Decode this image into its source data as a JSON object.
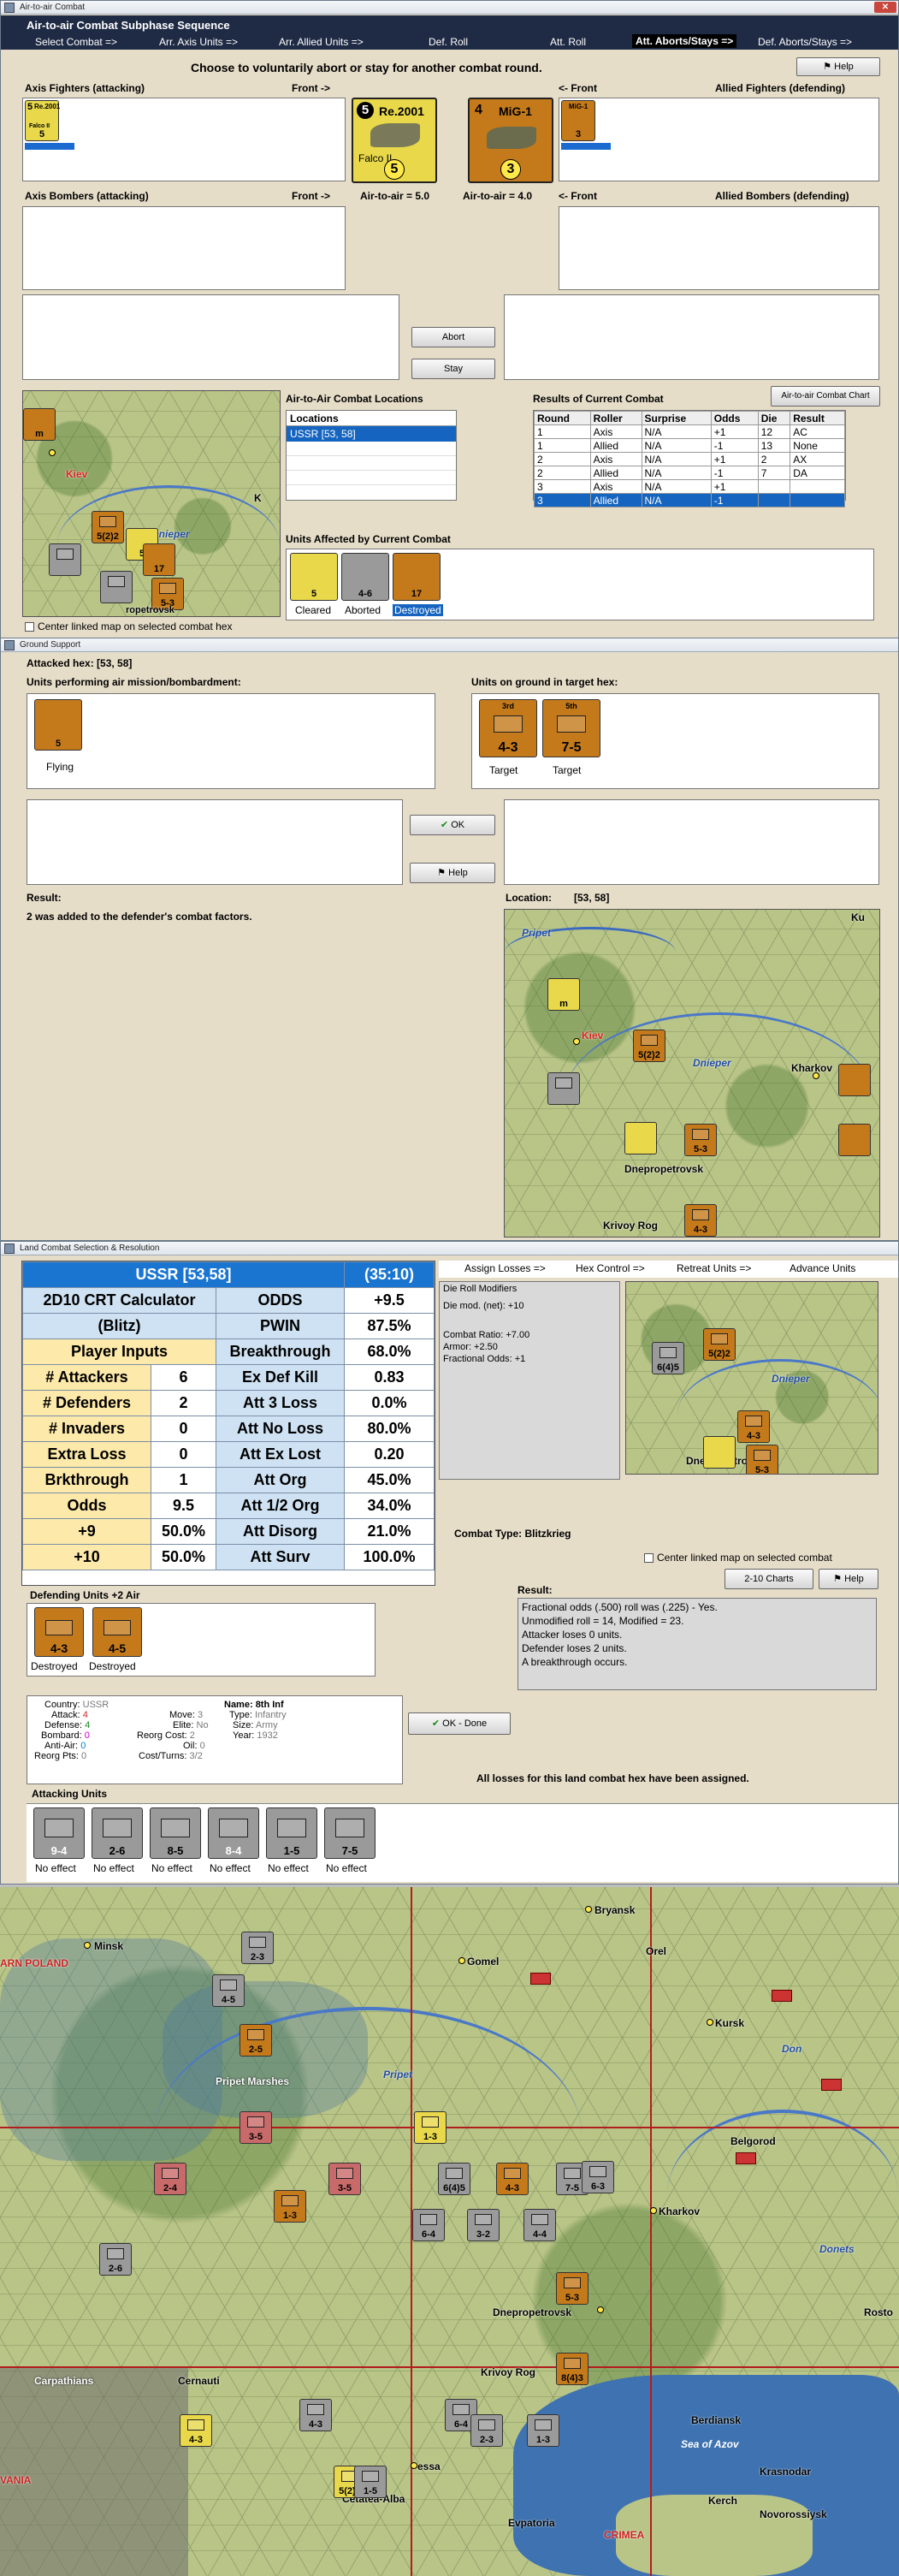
{
  "air_combat": {
    "window_title": "Air-to-air Combat",
    "panel_title": "Air-to-air Combat Subphase Sequence",
    "close": "✕",
    "tabs": [
      "Select Combat =>",
      "Arr. Axis Units =>",
      "Arr. Allied Units =>",
      "Def. Roll",
      "Att. Roll",
      "Att. Aborts/Stays =>",
      "Def. Aborts/Stays =>"
    ],
    "help": "Help",
    "instruction": "Choose to voluntarily abort or stay for another combat round.",
    "axis_fighters_label": "Axis Fighters (attacking)",
    "front_left": "Front ->",
    "front_right": "<- Front",
    "allied_fighters_label": "Allied Fighters (defending)",
    "axis_bombers_label": "Axis Bombers (attacking)",
    "allied_bombers_label": "Allied Bombers (defending)",
    "air_to_air_left": "Air-to-air = 5.0",
    "air_to_air_right": "Air-to-air = 4.0",
    "big_axis_counter": {
      "top": "5",
      "name": "Re.2001",
      "sub": "Falco II",
      "value": "5"
    },
    "big_soviet_counter": {
      "top": "4",
      "name": "MiG-1",
      "value": "3"
    },
    "small_axis_counter": {
      "top": "5",
      "name": "Re.2001",
      "sub": "Falco II",
      "value": "5"
    },
    "small_soviet_counter": {
      "name": "MiG-1",
      "value": "3"
    },
    "abort": "Abort",
    "stay": "Stay",
    "locations_title": "Air-to-Air Combat Locations",
    "locations_header": "Locations",
    "locations": [
      "USSR [53, 58]"
    ],
    "results_title": "Results of Current Combat",
    "chart_button": "Air-to-air Combat Chart",
    "results_headers": [
      "Round",
      "Roller",
      "Surprise",
      "Odds",
      "Die",
      "Result"
    ],
    "results_rows": [
      [
        "1",
        "Axis",
        "N/A",
        "+1",
        "12",
        "AC"
      ],
      [
        "1",
        "Allied",
        "N/A",
        "-1",
        "13",
        "None"
      ],
      [
        "2",
        "Axis",
        "N/A",
        "+1",
        "2",
        "AX"
      ],
      [
        "2",
        "Allied",
        "N/A",
        "-1",
        "7",
        "DA"
      ],
      [
        "3",
        "Axis",
        "N/A",
        "+1",
        "",
        ""
      ],
      [
        "3",
        "Allied",
        "N/A",
        "-1",
        "",
        ""
      ]
    ],
    "affected_title": "Units Affected by Current Combat",
    "affected": [
      {
        "label": "Cleared",
        "value": "5"
      },
      {
        "label": "Aborted",
        "value": "4-6"
      },
      {
        "label": "Destroyed",
        "value": "17"
      }
    ],
    "center_linked": "Center linked map on selected combat hex",
    "map": {
      "kiev": "Kiev",
      "dnieper": "Dnieper",
      "k": "K",
      "m": "m",
      "unit_a": "5(2)2",
      "unit_b": "5-3",
      "unit_c": "5",
      "unit_d": "17",
      "town": "ropetrovsk"
    }
  },
  "ground_support": {
    "window_title": "Ground Support",
    "attacked_hex": "Attacked hex:  [53, 58]",
    "air_units_label": "Units performing air mission/bombardment:",
    "ground_units_label": "Units on ground in target hex:",
    "flying_unit": {
      "value": "5",
      "label": "Flying"
    },
    "targets": [
      {
        "value": "4-3",
        "label": "Target",
        "top": "3rd"
      },
      {
        "value": "7-5",
        "label": "Target",
        "top": "5th"
      }
    ],
    "ok": "OK",
    "help": "Help",
    "result_label": "Result:",
    "result_text": "2 was added to the defender's combat factors.",
    "location_label": "Location:",
    "location_value": "[53, 58]",
    "map": {
      "pripet": "Pripet",
      "kiev": "Kiev",
      "dnieper": "Dnieper",
      "kharkov": "Kharkov",
      "dnepro": "Dnepropetrovsk",
      "krivoy": "Krivoy Rog",
      "ku": "Ku",
      "m": "m",
      "unit_a": "5(2)2",
      "unit_b": "5-3",
      "unit_c": "4-3"
    }
  },
  "land_combat": {
    "window_title": "Land Combat Selection & Resolution",
    "crt": {
      "title": "USSR [53,58]",
      "turn": "(35:10)",
      "rows": [
        [
          "2D10 CRT Calculator",
          "ODDS",
          "+9.5"
        ],
        [
          "(Blitz)",
          "PWIN",
          "87.5%"
        ],
        [
          "Player Inputs",
          "Breakthrough",
          "68.0%"
        ],
        [
          "# Attackers",
          "6",
          "Ex Def Kill",
          "0.83"
        ],
        [
          "# Defenders",
          "2",
          "Att 3 Loss",
          "0.0%"
        ],
        [
          "# Invaders",
          "0",
          "Att No Loss",
          "80.0%"
        ],
        [
          "Extra Loss",
          "0",
          "Att Ex Lost",
          "0.20"
        ],
        [
          "Brkthrough",
          "1",
          "Att Org",
          "45.0%"
        ],
        [
          "Odds",
          "9.5",
          "Att 1/2 Org",
          "34.0%"
        ],
        [
          "+9",
          "50.0%",
          "Att Disorg",
          "21.0%"
        ],
        [
          "+10",
          "50.0%",
          "Att Surv",
          "100.0%"
        ]
      ]
    },
    "tabs": [
      "Assign Losses =>",
      "Hex Control =>",
      "Retreat Units =>",
      "Advance Units"
    ],
    "die_roll_title": "Die Roll Modifiers",
    "die_roll_lines": [
      "Die mod. (net): +10",
      "",
      "Combat Ratio: +7.00",
      "Armor: +2.50",
      "Fractional Odds: +1"
    ],
    "combat_type": "Combat Type:  Blitzkrieg",
    "center_linked": "Center linked map on selected combat",
    "chart_button": "2-10 Charts",
    "help": "Help",
    "defending_label": "Defending Units +2 Air",
    "defending_units": [
      {
        "value": "4-3",
        "label": "Destroyed"
      },
      {
        "value": "4-5",
        "label": "Destroyed"
      }
    ],
    "result_label": "Result:",
    "result_lines": [
      "Fractional odds (.500) roll was (.225)  - Yes.",
      "Unmodified roll = 14, Modified = 23.",
      "Attacker loses 0 units.",
      "Defender loses 2 units.",
      "A breakthrough occurs."
    ],
    "unit_info": {
      "country_label": "Country:",
      "country": "USSR",
      "attack_label": "Attack:",
      "attack": "4",
      "defense_label": "Defense:",
      "defense": "4",
      "bombard_label": "Bombard:",
      "bombard": "0",
      "antiair_label": "Anti-Air:",
      "antiair": "0",
      "reorg_label": "Reorg Pts:",
      "reorg": "0",
      "move_label": "Move:",
      "move": "3",
      "elite_label": "Elite:",
      "elite": "No",
      "reorgcost_label": "Reorg Cost:",
      "reorgcost": "2",
      "oil_label": "Oil:",
      "oil": "0",
      "cost_label": "Cost/Turns:",
      "cost": "3/2",
      "name_label": "Name:",
      "name": "8th  Inf",
      "type_label": "Type:",
      "type": "Infantry",
      "size_label": "Size:",
      "size": "Army",
      "year_label": "Year:",
      "year": "1932"
    },
    "ok_done": "OK - Done",
    "all_losses": "All losses for this land combat hex have been assigned.",
    "attacking_label": "Attacking Units",
    "attacking_units": [
      {
        "value": "9-4",
        "label": "No effect"
      },
      {
        "value": "2-6",
        "label": "No effect"
      },
      {
        "value": "8-5",
        "label": "No effect"
      },
      {
        "value": "8-4",
        "label": "No effect"
      },
      {
        "value": "1-5",
        "label": "No effect"
      },
      {
        "value": "7-5",
        "label": "No effect"
      }
    ],
    "map": {
      "dnieper": "Dnieper",
      "dnepro": "Dnepropetrovsk",
      "unit_a": "6(4)5",
      "unit_b": "5(2)2",
      "unit_c": "5-3",
      "unit_d": "4-3"
    }
  },
  "main_map": {
    "labels": {
      "minsk": "Minsk",
      "bryansk": "Bryansk",
      "orel": "Orel",
      "gomel": "Gomel",
      "kursk": "Kursk",
      "don": "Don",
      "pripet_marshes": "Pripet Marshes",
      "pripet": "Pripet",
      "belgorod": "Belgorod",
      "poland": "ARN POLAND",
      "kharkov": "Kharkov",
      "donets": "Donets",
      "dnepro": "Dnepropetrovsk",
      "rostov": "Rosto",
      "krivoy": "Krivoy Rog",
      "carpathians": "Carpathians",
      "cernauti": "Cernauti",
      "berdiansk": "Berdiansk",
      "sea_azov": "Sea of Azov",
      "krasnodar": "Krasnodar",
      "odessa": "essa",
      "cetatea": "Cetatea-Alba",
      "evpatoria": "Evpatoria",
      "crimea": "CRIMEA",
      "kerch": "Kerch",
      "novorossiysk": "Novorossiysk",
      "vania": "VANIA"
    },
    "units": [
      "2-3",
      "4-5",
      "2-5",
      "3-5",
      "1-3",
      "2-4",
      "3-5",
      "1-3",
      "6(4)5",
      "2-6",
      "7-5",
      "4-3",
      "6-4",
      "3-2",
      "4-4",
      "8(4)3",
      "5-3",
      "5(2)3",
      "4-3",
      "6-4",
      "1-5",
      "4-3",
      "2-3",
      "1-3",
      "6-3"
    ]
  }
}
